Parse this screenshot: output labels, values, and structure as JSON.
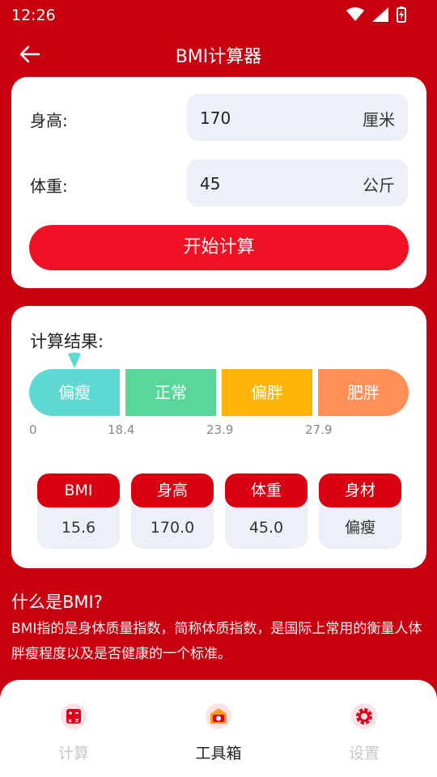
{
  "status": {
    "time": "12:26"
  },
  "header": {
    "title": "BMI计算器"
  },
  "form": {
    "height_label": "身高:",
    "height_value": "170",
    "height_unit": "厘米",
    "weight_label": "体重:",
    "weight_value": "45",
    "weight_unit": "公斤",
    "calc_button": "开始计算"
  },
  "result": {
    "title": "计算结果:",
    "segments": [
      {
        "label": "偏瘦",
        "color": "#5fd9d2"
      },
      {
        "label": "正常",
        "color": "#59d79b"
      },
      {
        "label": "偏胖",
        "color": "#ffb40a"
      },
      {
        "label": "肥胖",
        "color": "#ff8f57"
      }
    ],
    "ticks": [
      "0",
      "18.4",
      "23.9",
      "27.9"
    ],
    "stats": [
      {
        "label": "BMI",
        "value": "15.6"
      },
      {
        "label": "身高",
        "value": "170.0"
      },
      {
        "label": "体重",
        "value": "45.0"
      },
      {
        "label": "身材",
        "value": "偏瘦"
      }
    ]
  },
  "about": {
    "title": "什么是BMI?",
    "text": "BMI指的是身体质量指数，简称体质指数，是国际上常用的衡量人体胖瘦程度以及是否健康的一个标准。"
  },
  "nav": [
    {
      "label": "计算",
      "icon": "calculator-icon"
    },
    {
      "label": "工具箱",
      "icon": "toolbox-icon"
    },
    {
      "label": "设置",
      "icon": "gear-icon"
    }
  ],
  "colors": {
    "brand": "#c9000f",
    "button": "#f01125",
    "stat_head": "#d90012"
  }
}
